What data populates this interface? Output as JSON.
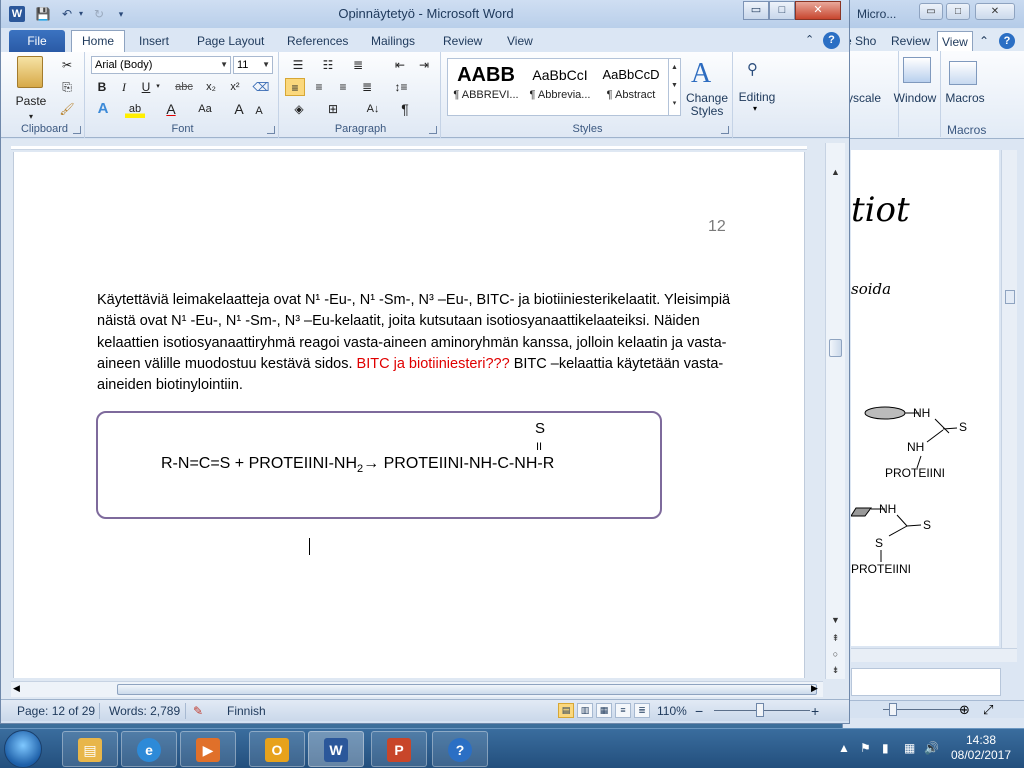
{
  "window": {
    "title": "Opinnäytetyö  -  Microsoft Word",
    "minimize": "▭",
    "maximize": "□",
    "close": "✕"
  },
  "tabs": {
    "file": "File",
    "items": [
      "Home",
      "Insert",
      "Page Layout",
      "References",
      "Mailings",
      "Review",
      "View"
    ],
    "active": "Home"
  },
  "ribbon": {
    "clipboard": {
      "label": "Clipboard",
      "paste": "Paste"
    },
    "font": {
      "label": "Font",
      "name": "Arial (Body)",
      "size": "11",
      "bold": "B",
      "italic": "I",
      "underline": "U",
      "strike": "abc",
      "sub": "x₂",
      "sup": "x²",
      "grow": "A",
      "shrink": "A",
      "case": "Aa"
    },
    "paragraph": {
      "label": "Paragraph",
      "pilcrow": "¶"
    },
    "styles": {
      "label": "Styles",
      "items": [
        {
          "preview": "AABB",
          "name": "¶ ABBREVI..."
        },
        {
          "preview": "AaBbCcI",
          "name": "¶ Abbrevia..."
        },
        {
          "preview": "AaBbCcD",
          "name": "¶ Abstract"
        }
      ],
      "change": "Change Styles"
    },
    "editing": {
      "label": "Editing"
    }
  },
  "document": {
    "page_number": "12",
    "paragraph": [
      {
        "text": "Käytettäviä leimakelaatteja ovat N¹ -Eu-, N¹ -Sm-, N³ –Eu-, BITC- ja biotiiniesterikelaatit. Yleisimpiä näistä ovat N¹ -Eu-, N¹ -Sm-, N³ –Eu-kelaatit, joita kutsutaan isotiosyanaattikelaateiksi. Näiden kelaattien isotiosyanaattiryhmä reagoi vasta-aineen aminoryhmän kanssa, jolloin kelaatin ja vasta-aineen välille muodostuu kestävä sidos. ",
        "color": "#000000"
      },
      {
        "text": "BITC ja biotiiniesteri???",
        "color": "#e00000"
      },
      {
        "text": " BITC –kelaattia käytetään  vasta-aineiden biotinylointiin.",
        "color": "#000000"
      }
    ],
    "equation": {
      "top_atom": "S",
      "double_bond": "II",
      "left": "R-N=C=S + PROTEIINI-NH",
      "subscript": "2",
      "arrow": "→",
      "right": " PROTEIINI-NH-C-NH-R"
    }
  },
  "statusbar": {
    "page": "Page: 12 of 29",
    "words": "Words: 2,789",
    "language": "Finnish",
    "zoom": "110%",
    "zoom_out": "−",
    "zoom_in": "+"
  },
  "background_window": {
    "title": "Micro...",
    "tabs": [
      "e Sho",
      "Review",
      "View"
    ],
    "ribbon": {
      "grayscale": "yscale",
      "window": "Window",
      "macros": "Macros",
      "macros_group": "Macros"
    },
    "doc": {
      "heading": "tiot",
      "sub": "soida",
      "label1_nh": "NH",
      "label1_s": "S",
      "label1_nh2": "NH",
      "label1_protein": "PROTEIINI",
      "label2_nh": "NH",
      "label2_s": "S",
      "label2_s2": "S",
      "label2_protein": "PROTEIINI"
    }
  },
  "taskbar": {
    "time": "14:38",
    "date": "08/02/2017",
    "apps": [
      {
        "name": "explorer",
        "glyph": "▤",
        "color": "#e8b64a"
      },
      {
        "name": "internet-explorer",
        "glyph": "e",
        "color": "#2d8ad8"
      },
      {
        "name": "media-player",
        "glyph": "▶",
        "color": "#e0702a"
      },
      {
        "name": "outlook",
        "glyph": "O",
        "color": "#e7a21c"
      },
      {
        "name": "word",
        "glyph": "W",
        "color": "#2b579a"
      },
      {
        "name": "powerpoint",
        "glyph": "P",
        "color": "#c8462a"
      },
      {
        "name": "help",
        "glyph": "?",
        "color": "#2b6fc4"
      }
    ]
  }
}
